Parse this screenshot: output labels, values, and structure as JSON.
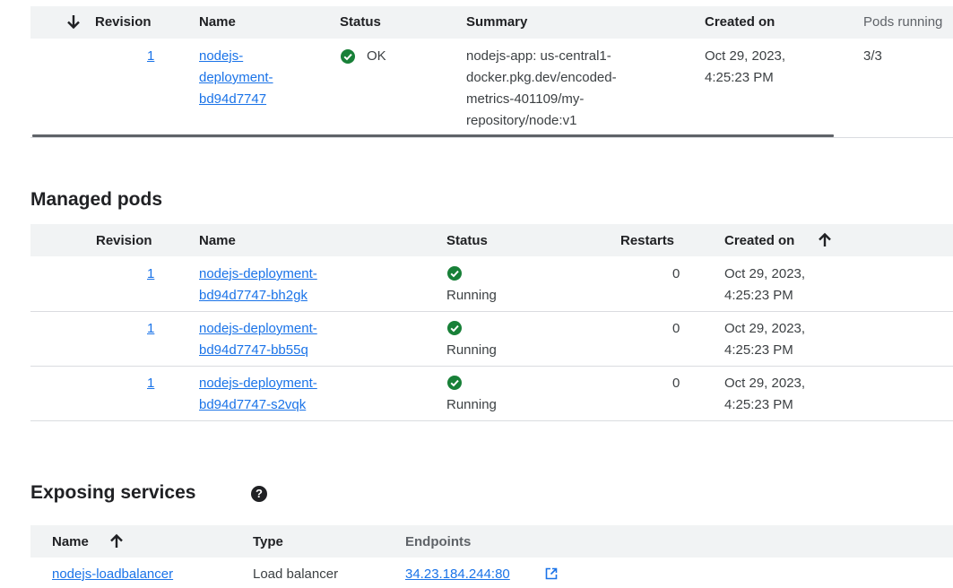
{
  "revisions_table": {
    "headers": {
      "revision": "Revision",
      "name": "Name",
      "status": "Status",
      "summary": "Summary",
      "created_on": "Created on",
      "pods_running": "Pods running"
    },
    "rows": [
      {
        "revision": "1",
        "name_lines": [
          "nodejs-",
          "deployment-",
          "bd94d7747"
        ],
        "status": "OK",
        "summary_lines": [
          "nodejs-app: us-central1-",
          "docker.pkg.dev/encoded-",
          "metrics-401109/my-",
          "repository/node:v1"
        ],
        "created_lines": [
          "Oct 29, 2023,",
          "4:25:23 PM"
        ],
        "pods_running": "3/3"
      }
    ]
  },
  "managed_pods": {
    "title": "Managed pods",
    "headers": {
      "revision": "Revision",
      "name": "Name",
      "status": "Status",
      "restarts": "Restarts",
      "created_on": "Created on"
    },
    "rows": [
      {
        "revision": "1",
        "name_lines": [
          "nodejs-deployment-",
          "bd94d7747-bh2gk"
        ],
        "status": "Running",
        "restarts": "0",
        "created_lines": [
          "Oct 29, 2023,",
          "4:25:23 PM"
        ]
      },
      {
        "revision": "1",
        "name_lines": [
          "nodejs-deployment-",
          "bd94d7747-bb55q"
        ],
        "status": "Running",
        "restarts": "0",
        "created_lines": [
          "Oct 29, 2023,",
          "4:25:23 PM"
        ]
      },
      {
        "revision": "1",
        "name_lines": [
          "nodejs-deployment-",
          "bd94d7747-s2vqk"
        ],
        "status": "Running",
        "restarts": "0",
        "created_lines": [
          "Oct 29, 2023,",
          "4:25:23 PM"
        ]
      }
    ]
  },
  "exposing_services": {
    "title": "Exposing services",
    "help_glyph": "?",
    "headers": {
      "name": "Name",
      "type": "Type",
      "endpoints": "Endpoints"
    },
    "rows": [
      {
        "name": "nodejs-loadbalancer",
        "type": "Load balancer",
        "endpoint": "34.23.184.244:80"
      }
    ]
  },
  "colors": {
    "header_bg": "#f1f3f4",
    "link": "#1a73e8",
    "ok_green": "#188038",
    "divider": "#dadce0"
  },
  "icons": {
    "sort_desc": "arrow-down-icon",
    "sort_asc": "arrow-up-icon",
    "status_ok": "check-circle-icon",
    "help": "help-icon",
    "external": "open-in-new-icon"
  }
}
